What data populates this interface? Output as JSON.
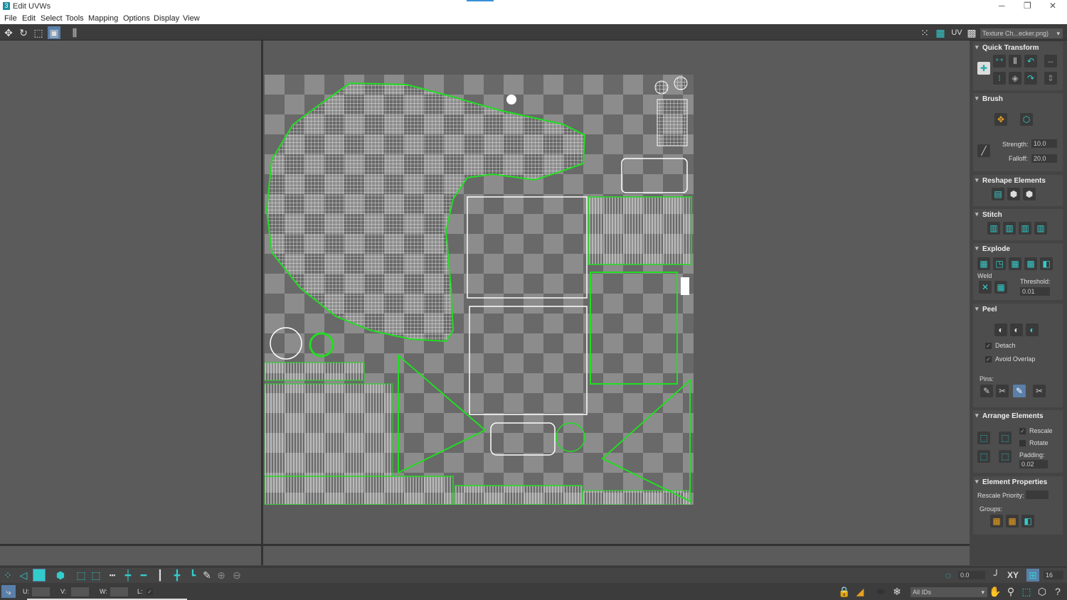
{
  "window": {
    "title": "Edit UVWs",
    "logo": "3"
  },
  "menu": [
    "File",
    "Edit",
    "Select",
    "Tools",
    "Mapping",
    "Options",
    "Display",
    "View"
  ],
  "toolbar": {
    "uv_label": "UV",
    "texture_dropdown": "Texture Ch...ecker.png)"
  },
  "panel": {
    "quick_transform": "Quick Transform",
    "brush": {
      "title": "Brush",
      "strength_label": "Strength:",
      "strength": "10.0",
      "falloff_label": "Falloff:",
      "falloff": "20.0"
    },
    "reshape": "Reshape Elements",
    "stitch": "Stitch",
    "explode": {
      "title": "Explode",
      "weld_label": "Weld",
      "threshold_label": "Threshold:",
      "threshold": "0.01"
    },
    "peel": {
      "title": "Peel",
      "detach": "Detach",
      "avoid_overlap": "Avoid Overlap",
      "pins_label": "Pins:",
      "detach_checked": true,
      "avoid_overlap_checked": true
    },
    "arrange": {
      "title": "Arrange Elements",
      "rescale": "Rescale",
      "rotate": "Rotate",
      "padding_label": "Padding:",
      "padding": "0.02",
      "rescale_checked": true,
      "rotate_checked": false
    },
    "element_props": {
      "title": "Element Properties",
      "rescale_priority_label": "Rescale Priority:",
      "groups_label": "Groups:"
    }
  },
  "bottom": {
    "angle": "0.0",
    "xy": "XY",
    "grid_value": "16",
    "u_label": "U:",
    "v_label": "V:",
    "w_label": "W:",
    "l_label": "L:",
    "ids_dropdown": "All IDs"
  },
  "colors": {
    "accent": "#3cc8c8",
    "uv_edge": "#22dd22",
    "wire": "#ffffff"
  }
}
